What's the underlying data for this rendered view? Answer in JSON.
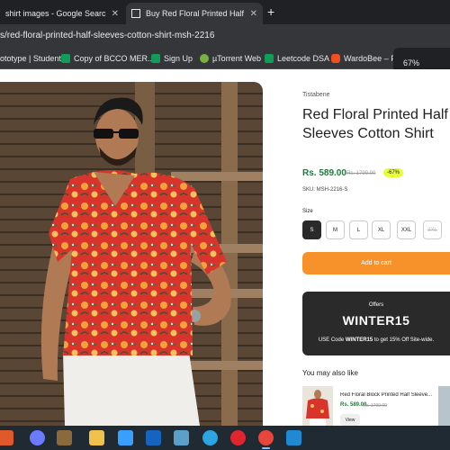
{
  "browser": {
    "tabs": [
      {
        "title": "shirt images - Google Search",
        "active": false
      },
      {
        "title": "Buy Red Floral Printed Half Slee",
        "active": true
      }
    ],
    "new_tab_label": "+",
    "close_glyph": "✕",
    "url": "s/red-floral-printed-half-sleeves-cotton-shirt-msh-2216",
    "bookmarks": [
      {
        "label": "ototype | Student",
        "icon": "bookmark-icon",
        "color": "#5f6368"
      },
      {
        "label": "Copy of BCCO MER...",
        "icon": "sheets-icon",
        "color": "#0f9d58"
      },
      {
        "label": "Sign Up",
        "icon": "sheets-icon",
        "color": "#0f9d58"
      },
      {
        "label": "µTorrent Web",
        "icon": "utorrent-icon",
        "color": "#78b13f"
      },
      {
        "label": "Leetcode DSA",
        "icon": "sheets-icon",
        "color": "#0f9d58"
      },
      {
        "label": "WardoBee – Figm",
        "icon": "figma-icon",
        "color": "#f24e1e"
      }
    ],
    "zoom_popup": "67%"
  },
  "product": {
    "brand": "Tistabene",
    "title": "Red Floral Printed Half Sleeves Cotton Shirt",
    "price": "Rs. 589.00",
    "old_price": "Rs. 1799.00",
    "discount": "-67%",
    "sku": "SKU: MSH-2216-S",
    "size_label": "Size",
    "sizes": [
      {
        "label": "S",
        "selected": true,
        "available": true
      },
      {
        "label": "M",
        "selected": false,
        "available": true
      },
      {
        "label": "L",
        "selected": false,
        "available": true
      },
      {
        "label": "XL",
        "selected": false,
        "available": true
      },
      {
        "label": "XXL",
        "selected": false,
        "available": true
      },
      {
        "label": "3XL",
        "selected": false,
        "available": false
      }
    ],
    "add_to_cart": "Add to cart"
  },
  "offers": {
    "label": "Offers",
    "code": "WINTER15",
    "desc_prefix": "USE Code ",
    "desc_code": "WINTER15",
    "desc_suffix": " to get 15% Off Site-wide."
  },
  "recommendations": {
    "heading": "You may also like",
    "items": [
      {
        "name": "Red Floral Block Printed Half Sleeve...",
        "price": "Rs. 589.00",
        "old_price": "Rs. 1799.00",
        "view_label": "View"
      }
    ]
  },
  "colors": {
    "accent_orange": "#f7912a",
    "price_green": "#1f7a3a",
    "discount_yellow": "#e7ff3a",
    "dark_panel": "#2a2a2a"
  },
  "taskbar": {
    "icons": [
      {
        "name": "start-icon",
        "color": "#e0592a"
      },
      {
        "name": "copilot-icon",
        "color": "#6b7bff"
      },
      {
        "name": "gallery-icon",
        "color": "#8a6a3d"
      },
      {
        "name": "edge-icon",
        "color": "#1fa0d8"
      },
      {
        "name": "file-explorer-icon",
        "color": "#f0c14b"
      },
      {
        "name": "store-icon",
        "color": "#3aa0ff"
      },
      {
        "name": "outlook-icon",
        "color": "#1565c0"
      },
      {
        "name": "notepad-icon",
        "color": "#5aa0c8"
      },
      {
        "name": "telegram-icon",
        "color": "#2ca5e0"
      },
      {
        "name": "opera-icon",
        "color": "#e0252f"
      },
      {
        "name": "chrome-icon",
        "color": "#e8453c",
        "active": true
      },
      {
        "name": "vscode-icon",
        "color": "#1f8ad2"
      }
    ]
  }
}
